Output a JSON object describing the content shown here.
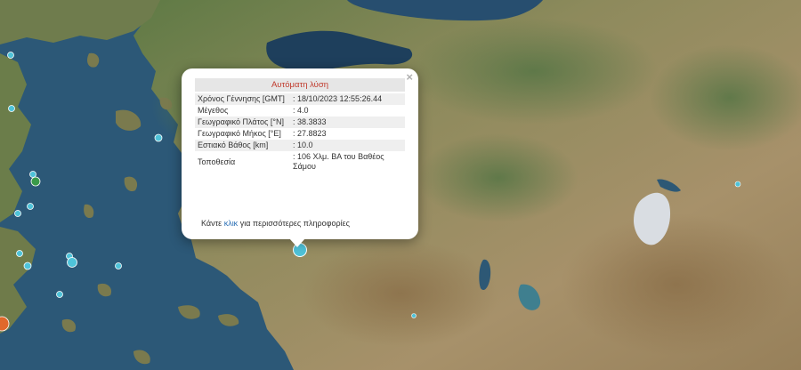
{
  "popup": {
    "title": "Αυτόματη λύση",
    "rows": [
      {
        "label": "Χρόνος Γέννησης [GMT]",
        "value": ": 18/10/2023 12:55:26.44"
      },
      {
        "label": "Μέγεθος",
        "value": ": 4.0"
      },
      {
        "label": "Γεωγραφικό Πλάτος [°N]",
        "value": ": 38.3833"
      },
      {
        "label": "Γεωγραφικό Μήκος [°E]",
        "value": ": 27.8823"
      },
      {
        "label": "Εστιακό Βάθος [km]",
        "value": ": 10.0"
      },
      {
        "label": "Τοποθεσία",
        "value": ": 106 Χλμ. ΒΑ του Βαθέος Σάμου"
      }
    ],
    "more_prefix": "Κάντε",
    "more_link": "κλικ",
    "more_suffix": "για περισσότερες πληροφορίες",
    "close_glyph": "×"
  },
  "colors": {
    "sea": "#2c5877",
    "land": "#9c8a62",
    "quake_marker": "#4fc3d9",
    "quake_marker_large": "#e0682b",
    "popup_title": "#c0392b",
    "link": "#2a6fb5"
  },
  "icons": [
    "close-icon",
    "earthquake-marker"
  ]
}
